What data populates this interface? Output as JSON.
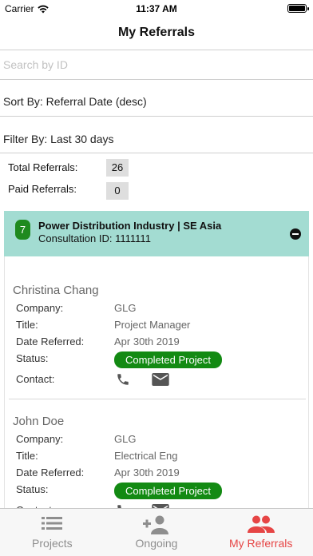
{
  "status_bar": {
    "carrier": "Carrier",
    "time": "11:37 AM"
  },
  "nav": {
    "title": "My Referrals"
  },
  "search": {
    "placeholder": "Search by ID",
    "value": ""
  },
  "sort": {
    "label": "Sort By: Referral Date (desc)"
  },
  "filter": {
    "label": "Filter By: Last 30 days"
  },
  "totals": {
    "total_label": "Total Referrals:",
    "total_value": "26",
    "paid_label": "Paid Referrals:",
    "paid_value": "0"
  },
  "project": {
    "badge": "7",
    "title": "Power Distribution Industry | SE Asia",
    "consultation": "Consultation ID: 1111111",
    "header_color": "#a3dcd2"
  },
  "labels": {
    "company": "Company:",
    "title": "Title:",
    "date_referred": "Date Referred:",
    "status": "Status:",
    "contact": "Contact:"
  },
  "referrals": [
    {
      "name": "Christina Chang",
      "company": "GLG",
      "title": "Project Manager",
      "date_referred": "Apr 30th 2019",
      "status": "Completed Project"
    },
    {
      "name": "John Doe",
      "company": "GLG",
      "title": "Electrical Eng",
      "date_referred": "Apr 30th 2019",
      "status": "Completed Project"
    }
  ],
  "colors": {
    "status_green": "#138a13",
    "active_tab": "#e64545",
    "inactive_tab": "#8e8e8e"
  },
  "tabs": [
    {
      "label": "Projects",
      "icon": "list-icon",
      "active": false
    },
    {
      "label": "Ongoing",
      "icon": "add-person-icon",
      "active": false
    },
    {
      "label": "My Referrals",
      "icon": "people-icon",
      "active": true
    }
  ]
}
